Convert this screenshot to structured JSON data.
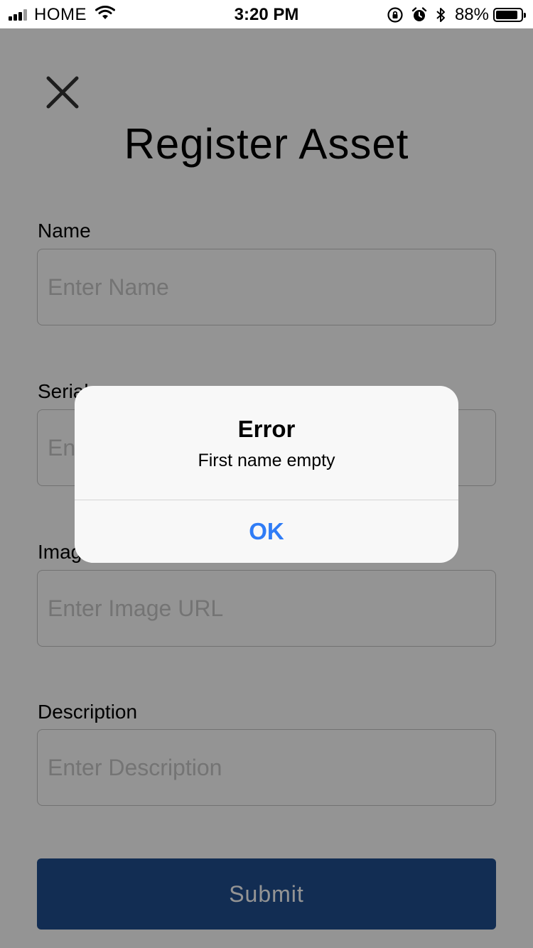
{
  "status_bar": {
    "carrier": "HOME",
    "time": "3:20 PM",
    "battery_percent": "88%",
    "battery_level": 0.88
  },
  "header": {
    "title": "Register Asset",
    "close_icon": "close-icon"
  },
  "form": {
    "fields": [
      {
        "label": "Name",
        "placeholder": "Enter Name",
        "value": ""
      },
      {
        "label": "Serial",
        "placeholder": "Enter Serial",
        "value": ""
      },
      {
        "label": "Image",
        "placeholder": "Enter Image URL",
        "value": ""
      },
      {
        "label": "Description",
        "placeholder": "Enter Description",
        "value": ""
      }
    ],
    "submit_label": "Submit"
  },
  "alert": {
    "title": "Error",
    "message": "First name empty",
    "ok_label": "OK"
  },
  "colors": {
    "accent": "#2f7cf6",
    "submit_bg": "#1f4f8f",
    "overlay": "rgba(0,0,0,0.42)"
  }
}
